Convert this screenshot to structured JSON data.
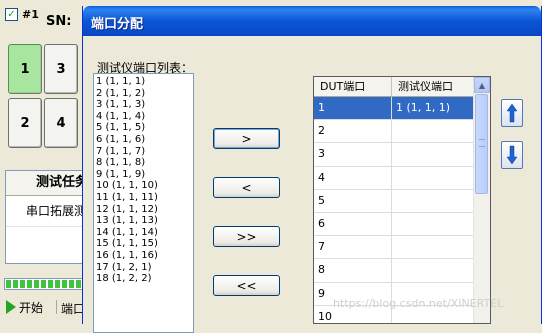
{
  "background": {
    "station_no": "#1",
    "sn_label": "SN:",
    "port_buttons": [
      "1",
      "3",
      "2",
      "4"
    ],
    "panel_header": "测试任务",
    "panel_row": "串口拓展测",
    "start_label": "开始",
    "port_label": "端口"
  },
  "dialog": {
    "title": "端口分配",
    "list_label": "测试仪端口列表：",
    "tester_ports": [
      "1 (1, 1, 1)",
      "2 (1, 1, 2)",
      "3 (1, 1, 3)",
      "4 (1, 1, 4)",
      "5 (1, 1, 5)",
      "6 (1, 1, 6)",
      "7 (1, 1, 7)",
      "8 (1, 1, 8)",
      "9 (1, 1, 9)",
      "10 (1, 1, 10)",
      "11 (1, 1, 11)",
      "12 (1, 1, 12)",
      "13 (1, 1, 13)",
      "14 (1, 1, 14)",
      "15 (1, 1, 15)",
      "16 (1, 1, 16)",
      "17 (1, 2, 1)",
      "18 (1, 2, 2)"
    ],
    "move_buttons": [
      ">",
      "<",
      ">>",
      "<<"
    ],
    "table": {
      "headers": [
        "DUT端口",
        "测试仪端口"
      ],
      "rows": [
        [
          "1",
          "1 (1, 1, 1)"
        ],
        [
          "2",
          ""
        ],
        [
          "3",
          ""
        ],
        [
          "4",
          ""
        ],
        [
          "5",
          ""
        ],
        [
          "6",
          ""
        ],
        [
          "7",
          ""
        ],
        [
          "8",
          ""
        ],
        [
          "9",
          ""
        ],
        [
          "10",
          ""
        ]
      ],
      "selected_row": 0
    },
    "order_buttons": [
      "move-up",
      "move-down"
    ]
  },
  "watermark": "https://blog.csdn.net/XINERTEL",
  "colors": {
    "title_bar": "#0b56d6",
    "selection": "#316ac5",
    "active_port": "#a8e6a0",
    "progress": "#3fc33f"
  }
}
